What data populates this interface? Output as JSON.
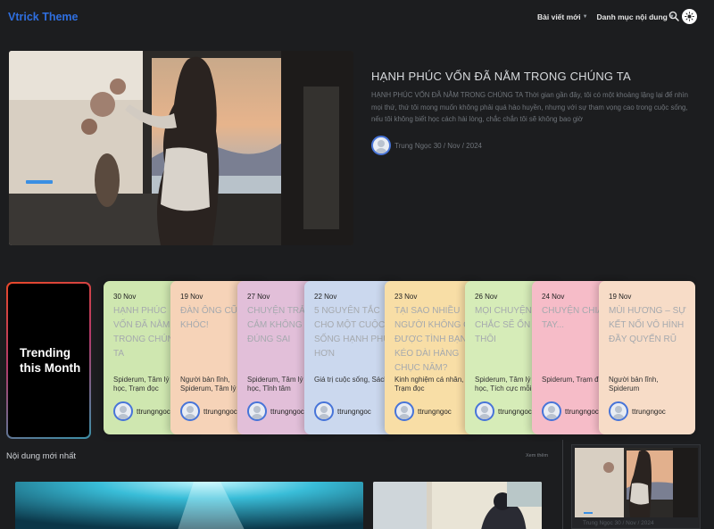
{
  "header": {
    "logo": "Vtrick Theme",
    "nav": [
      {
        "label": "Bài viết mới"
      },
      {
        "label": "Danh mục nội dung"
      }
    ],
    "icons": [
      "search-icon",
      "sun-icon"
    ]
  },
  "hero": {
    "title": "HẠNH PHÚC VỐN ĐÃ NẰM TRONG CHÚNG TA",
    "excerpt": "HẠNH PHÚC VỐN ĐÃ NẰM TRONG CHÚNG TA Thời gian gần đây, tôi có một khoảng lặng lại để nhìn mọi thứ, thứ tôi mong muốn không phải quá hào huyền, nhưng với sự tham vọng cao trong cuộc sống, nếu tôi không biết học cách hài lòng, chắc chắn tôi sẽ không bao giờ",
    "author_line": "Trung Ngọc 30 / Nov / 2024"
  },
  "trending": {
    "label": "Trending this Month",
    "cards": [
      {
        "date": "30 Nov",
        "title": "HẠNH PHÚC\nVỐN ĐÃ NẰM\nTRONG CHÚNG\nTA",
        "tags": "Spiderum, Tâm lý\nhọc, Trạm đọc",
        "author": "ttrungngoc",
        "color": "#cfe7b0"
      },
      {
        "date": "19 Nov",
        "title": "ĐÀN ÔNG CŨNG\nKHÓC!",
        "tags": "Người bản lĩnh,\nSpiderum, Tâm lý",
        "author": "ttrungngoc",
        "color": "#f6d3b8"
      },
      {
        "date": "27 Nov",
        "title": "CHUYỆN TRẢI\nCẢM KHÔNG CÓ\nĐÚNG SAI",
        "tags": "Spiderum, Tâm lý\nhọc, Tĩnh tâm",
        "author": "ttrungngoc",
        "color": "#e2bfd9"
      },
      {
        "date": "22 Nov",
        "title": "5 NGUYÊN TẮC\nCHO MỘT CUỘC\nSỐNG HẠNH PHÚC\nHƠN",
        "tags": "Giá trị cuộc sống, Sách",
        "author": "ttrungngoc",
        "color": "#cbd8ee"
      },
      {
        "date": "23 Nov",
        "title": "TẠI SAO NHIỀU\nNGƯỜI KHÔNG CÓ\nĐƯỢC TÌNH BẠN\nKÉO DÀI HÀNG\nCHỤC NĂM?",
        "tags": "Kinh nghiệm cá nhân,\nTrạm đọc",
        "author": "ttrungngoc",
        "color": "#f8dea6"
      },
      {
        "date": "26 Nov",
        "title": "MỌI CHUYỆN\nCHẮC SẼ ỔN\nTHÔI",
        "tags": "Spiderum, Tâm lý\nhọc, Tích cực mỗi",
        "author": "ttrungngoc",
        "color": "#d6ecb8"
      },
      {
        "date": "24 Nov",
        "title": "CHUYỆN CHIA\nTAY...",
        "tags": "Spiderum, Trạm đọc",
        "author": "ttrungngoc",
        "color": "#f6bcc8"
      },
      {
        "date": "19 Nov",
        "title": "MÙI HƯƠNG – SỰ\nKẾT NỐI VÔ HÌNH\nĐẦY QUYẾN RŨ",
        "tags": "Người bản lĩnh,\nSpiderum",
        "author": "ttrungngoc",
        "color": "#f7dcc7"
      }
    ]
  },
  "new_content": {
    "title": "Nội dung mới nhất",
    "see_more": "Xem thêm",
    "side_caption": "Trung Ngọc 30 / Nov / 2024"
  }
}
